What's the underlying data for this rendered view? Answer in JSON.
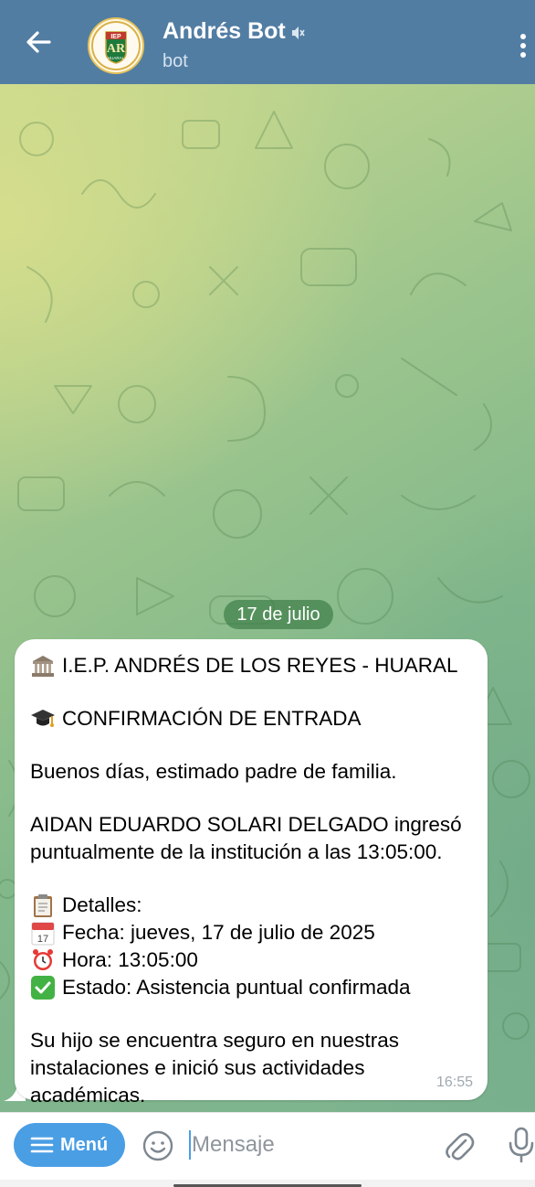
{
  "header": {
    "title": "Andrés Bot",
    "subtitle": "bot",
    "avatar_text_top": "IEP",
    "avatar_text_mid": "AR",
    "avatar_text_bottom": "HUARAL",
    "header_color": "#527da3"
  },
  "chat": {
    "date_label": "17 de julio",
    "message": {
      "line1": "I.E.P. ANDRÉS DE LOS REYES - HUARAL",
      "line2": "CONFIRMACIÓN DE ENTRADA",
      "line3": "Buenos días, estimado padre de familia.",
      "line4a": "AIDAN EDUARDO SOLARI DELGADO ingresó",
      "line4b": "puntualmente de la institución a las 13:05:00.",
      "details_title": "Detalles:",
      "fecha": "Fecha: jueves, 17 de julio de 2025",
      "hora": "Hora: 13:05:00",
      "estado": "Estado: Asistencia puntual confirmada",
      "closing1": "Su hijo se encuentra seguro en nuestras",
      "closing2": "instalaciones e inició sus actividades",
      "closing3": "académicas.",
      "calendar_day": "17",
      "time": "16:55",
      "icons": [
        "classical-building-icon",
        "graduation-cap-icon",
        "clipboard-icon",
        "calendar-icon",
        "alarm-clock-icon",
        "check-mark-icon"
      ]
    }
  },
  "input_bar": {
    "menu_label": "Menú",
    "placeholder": "Mensaje",
    "accent_color": "#4a9ee4"
  }
}
